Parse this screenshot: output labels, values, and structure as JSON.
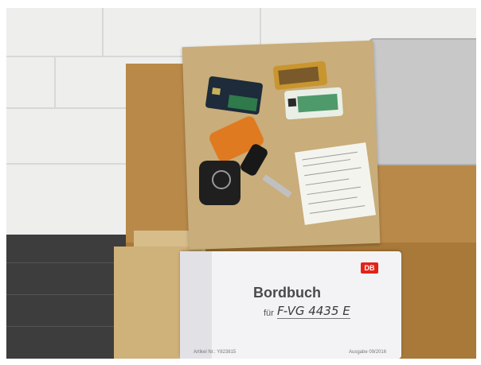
{
  "binder": {
    "title": "Bordbuch",
    "for_label": "für",
    "plate": "F-VG 4435 E",
    "logo": "DB",
    "footer_left": "Artikel Nr.: Y823815",
    "footer_right": "Ausgabe 09/2016"
  },
  "colors": {
    "table_wood": "#b98949",
    "envelope_kraft": "#c9ad7a",
    "db_red": "#e2231a",
    "key_orange": "#e07a20"
  }
}
